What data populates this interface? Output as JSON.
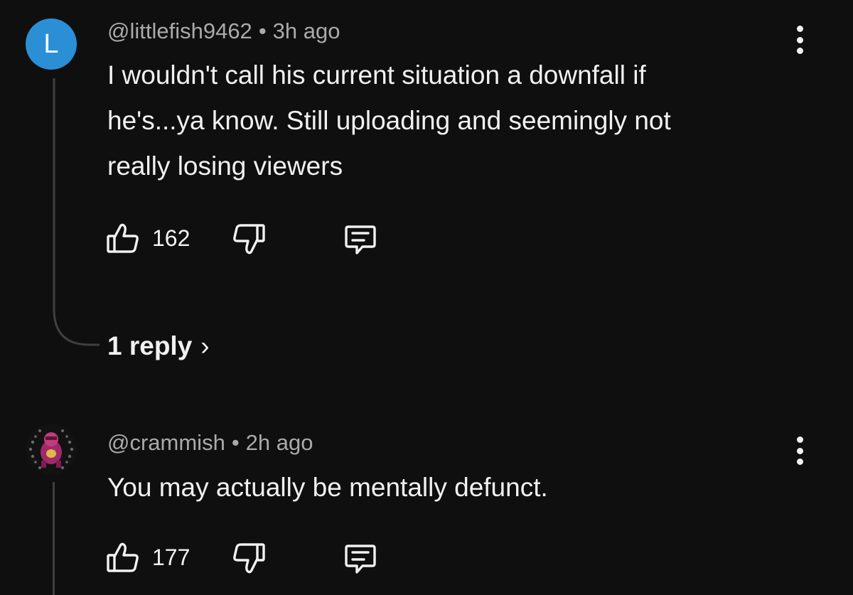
{
  "comments": [
    {
      "avatar_letter": "L",
      "avatar_color": "#2b8fd6",
      "handle": "@littlefish9462",
      "separator": "•",
      "time": "3h ago",
      "text_lines": [
        "I wouldn't call his current situation a downfall if",
        "he's...ya know. Still uploading and seemingly not",
        "really losing viewers"
      ],
      "likes": "162",
      "replies_label": "1 reply",
      "replies_chevron": "›"
    },
    {
      "avatar_icon": "profile-picture",
      "handle": "@crammish",
      "separator": "•",
      "time": "2h ago",
      "text_lines": [
        "You may actually be mentally defunct."
      ],
      "likes": "177"
    }
  ],
  "colors": {
    "background": "#0f0f0f",
    "primary_text": "#f1f1f1",
    "secondary_text": "#aaaaaa",
    "thread_line": "#3f3f3f"
  },
  "icons": {
    "like": "thumbs-up-icon",
    "dislike": "thumbs-down-icon",
    "reply": "comment-icon",
    "menu": "kebab-menu-icon"
  }
}
